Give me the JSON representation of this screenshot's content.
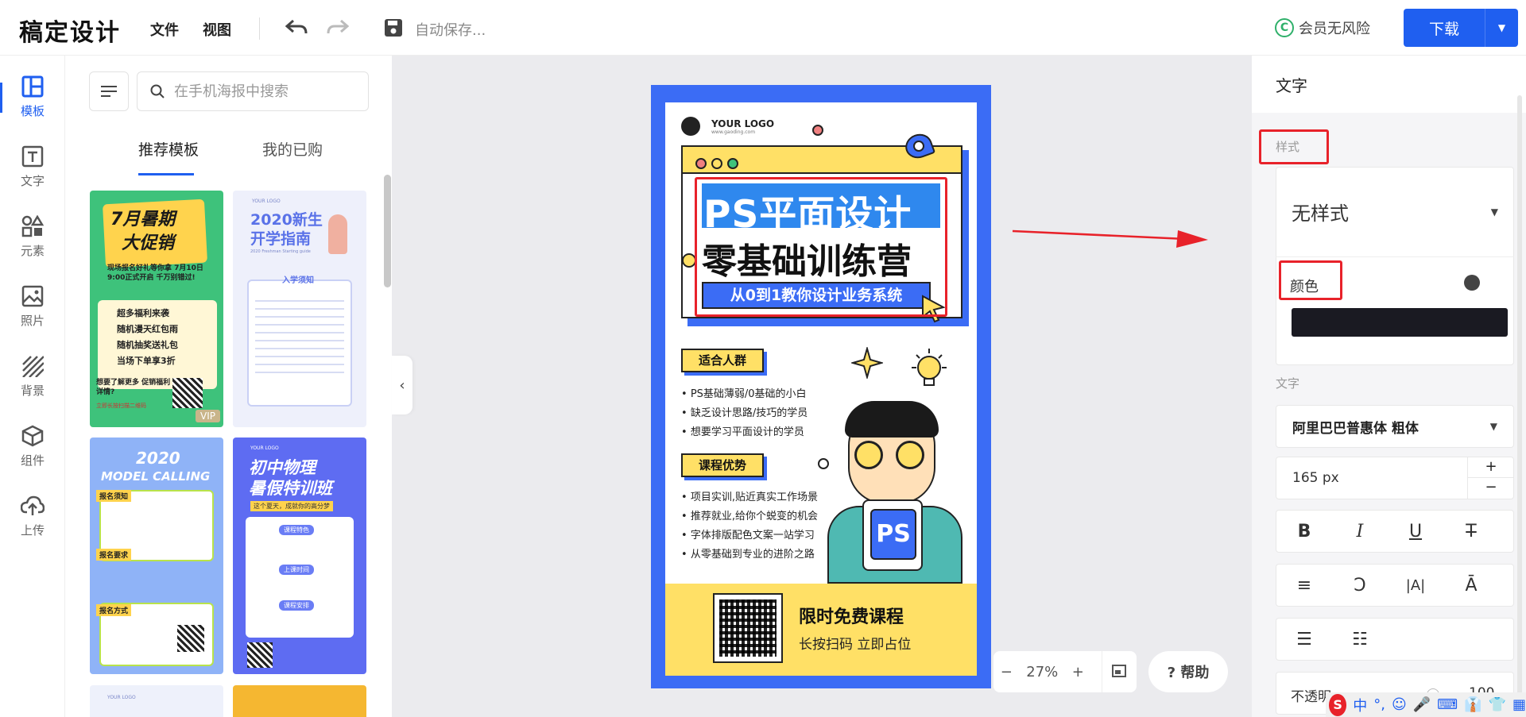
{
  "app": {
    "logo": "稿定设计",
    "menu_file": "文件",
    "menu_view": "视图",
    "autosave": "自动保存...",
    "vip": "会员无风险",
    "download": "下载"
  },
  "nav": [
    {
      "label": "模板",
      "icon": "template-icon"
    },
    {
      "label": "文字",
      "icon": "text-icon"
    },
    {
      "label": "元素",
      "icon": "elements-icon"
    },
    {
      "label": "照片",
      "icon": "photo-icon"
    },
    {
      "label": "背景",
      "icon": "background-icon"
    },
    {
      "label": "组件",
      "icon": "component-icon"
    },
    {
      "label": "上传",
      "icon": "upload-icon"
    }
  ],
  "templates": {
    "search_placeholder": "在手机海报中搜索",
    "tabs": [
      "推荐模板",
      "我的已购"
    ],
    "t1": {
      "title1": "7月暑期",
      "title2": "大促销",
      "desc": "现场报名好礼等你拿 7月10日9:00正式开启 千万别错过!",
      "items": [
        "超多福利来袭",
        "随机漫天红包雨",
        "随机抽奖送礼包",
        "当场下单享3折"
      ],
      "cta": "想要了解更多 促销福利详情?",
      "cta2": "立即长按扫描二维码",
      "badge": "VIP"
    },
    "t2": {
      "logo": "YOUR LOGO",
      "title1": "2020新生",
      "title2": "开学指南",
      "sub": "2020 Freshman Starting guide",
      "sec": "入学须知"
    },
    "t3": {
      "title1": "2020",
      "title2": "MODEL CALLING",
      "labels": [
        "报名须知",
        "报名要求",
        "报名方式"
      ]
    },
    "t4": {
      "logo": "YOUR LOGO",
      "title1": "初中物理",
      "title2": "暑假特训班",
      "sub": "这个夏天，成就你的高分梦",
      "secs": [
        "课程特色",
        "上课时间",
        "课程安排"
      ]
    },
    "t5": {
      "logo": "YOUR LOGO"
    }
  },
  "poster": {
    "logo": "YOUR LOGO",
    "logo_url": "www.gaoding.com",
    "title1": "PS平面设计",
    "title2": "零基础训练营",
    "subtitle": "从0到1教你设计业务系统",
    "sec1": "适合人群",
    "sec1_items": [
      "PS基础薄弱/0基础的小白",
      "缺乏设计思路/技巧的学员",
      "想要学习平面设计的学员"
    ],
    "sec2": "课程优势",
    "sec2_items": [
      "项目实训,贴近真实工作场景",
      "推荐就业,给你个蜕变的机会",
      "字体排版配色文案一站学习",
      "从零基础到专业的进阶之路"
    ],
    "ps": "PS",
    "free": "限时免费课程",
    "scan": "长按扫码 立即占位"
  },
  "zoom": {
    "value": "27%",
    "minus": "−",
    "plus": "+"
  },
  "help": "? 帮助",
  "panel": {
    "title": "文字",
    "style_label": "样式",
    "style_value": "无样式",
    "color_label": "颜色",
    "color": "#1a1a22",
    "text_label": "文字",
    "font": "阿里巴巴普惠体 粗体",
    "size": "165 px",
    "opacity_label": "不透明",
    "opacity": "100",
    "opacity_fraction": 0.97
  },
  "colors": {
    "accent": "#1f5ff0",
    "poster_blue": "#3b6cf5",
    "poster_yellow": "#ffe066",
    "highlight": "#2f88ee",
    "red": "#e8222a"
  }
}
